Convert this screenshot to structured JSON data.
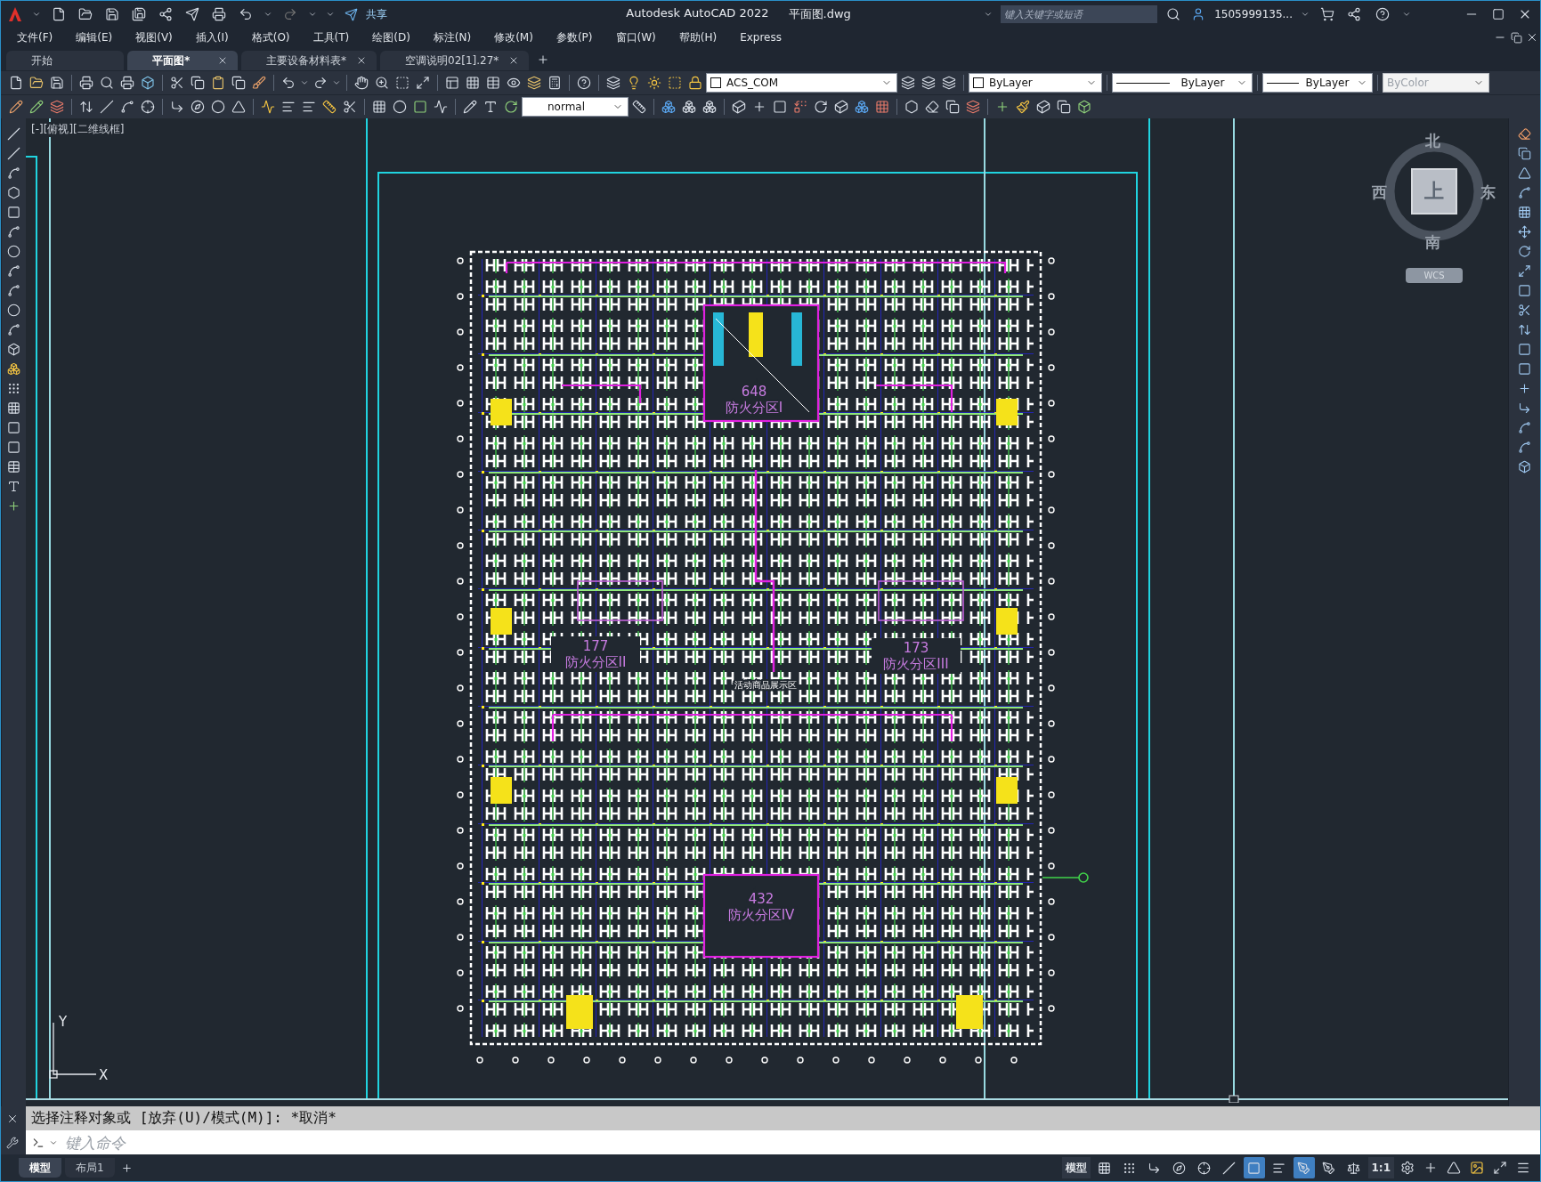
{
  "title_bar": {
    "share": "共享",
    "app_title": "Autodesk AutoCAD 2022",
    "file_name": "平面图.dwg",
    "search": {
      "placeholder": "键入关键字或短语"
    },
    "user": "1505999135..."
  },
  "menu": [
    "文件(F)",
    "编辑(E)",
    "视图(V)",
    "插入(I)",
    "格式(O)",
    "工具(T)",
    "绘图(D)",
    "标注(N)",
    "修改(M)",
    "参数(P)",
    "窗口(W)",
    "帮助(H)",
    "Express"
  ],
  "doc_tabs": [
    {
      "label": "开始",
      "selected": false,
      "closable": false
    },
    {
      "label": "平面图*",
      "selected": true,
      "closable": true
    },
    {
      "label": "主要设备材料表*",
      "selected": false,
      "closable": true
    },
    {
      "label": "空调说明02[1].27*",
      "selected": false,
      "closable": true
    }
  ],
  "properties_toolbar": {
    "layer": "ACS_COM",
    "color_control": "ByLayer",
    "linetype": "ByLayer",
    "lineweight": "ByLayer",
    "plot_style": {
      "value": "ByColor",
      "disabled": true
    }
  },
  "dim_style": "normal",
  "viewport_label": "[-][俯视][二维线框]",
  "drawing": {
    "zones": [
      {
        "area": "648",
        "name": "防火分区I"
      },
      {
        "area": "177",
        "name": "防火分区II"
      },
      {
        "area": "173",
        "name": "防火分区III"
      },
      {
        "area": "432",
        "name": "防火分区IV"
      }
    ],
    "area_label": "活动商品展示区"
  },
  "view_cube": {
    "north": "北",
    "west": "西",
    "face": "上",
    "east": "东",
    "south": "南",
    "coordinate_system": "WCS"
  },
  "ucs": {
    "y": "Y",
    "x": "X"
  },
  "command_line": {
    "history": "选择注释对象或 [放弃(U)/模式(M)]: *取消*",
    "placeholder": "键入命令"
  },
  "layout_tabs": [
    {
      "label": "模型",
      "selected": true
    },
    {
      "label": "布局1",
      "selected": false
    }
  ],
  "status_bar": {
    "space": "模型",
    "scale": "1:1",
    "toggles": [
      {
        "on": false
      },
      {
        "on": false
      },
      {
        "on": false
      },
      {
        "on": false
      },
      {
        "on": false
      },
      {
        "on": false
      },
      {
        "on": true
      },
      {
        "on": false
      },
      {
        "on": true
      },
      {
        "on": false
      },
      {
        "on": false
      }
    ]
  }
}
